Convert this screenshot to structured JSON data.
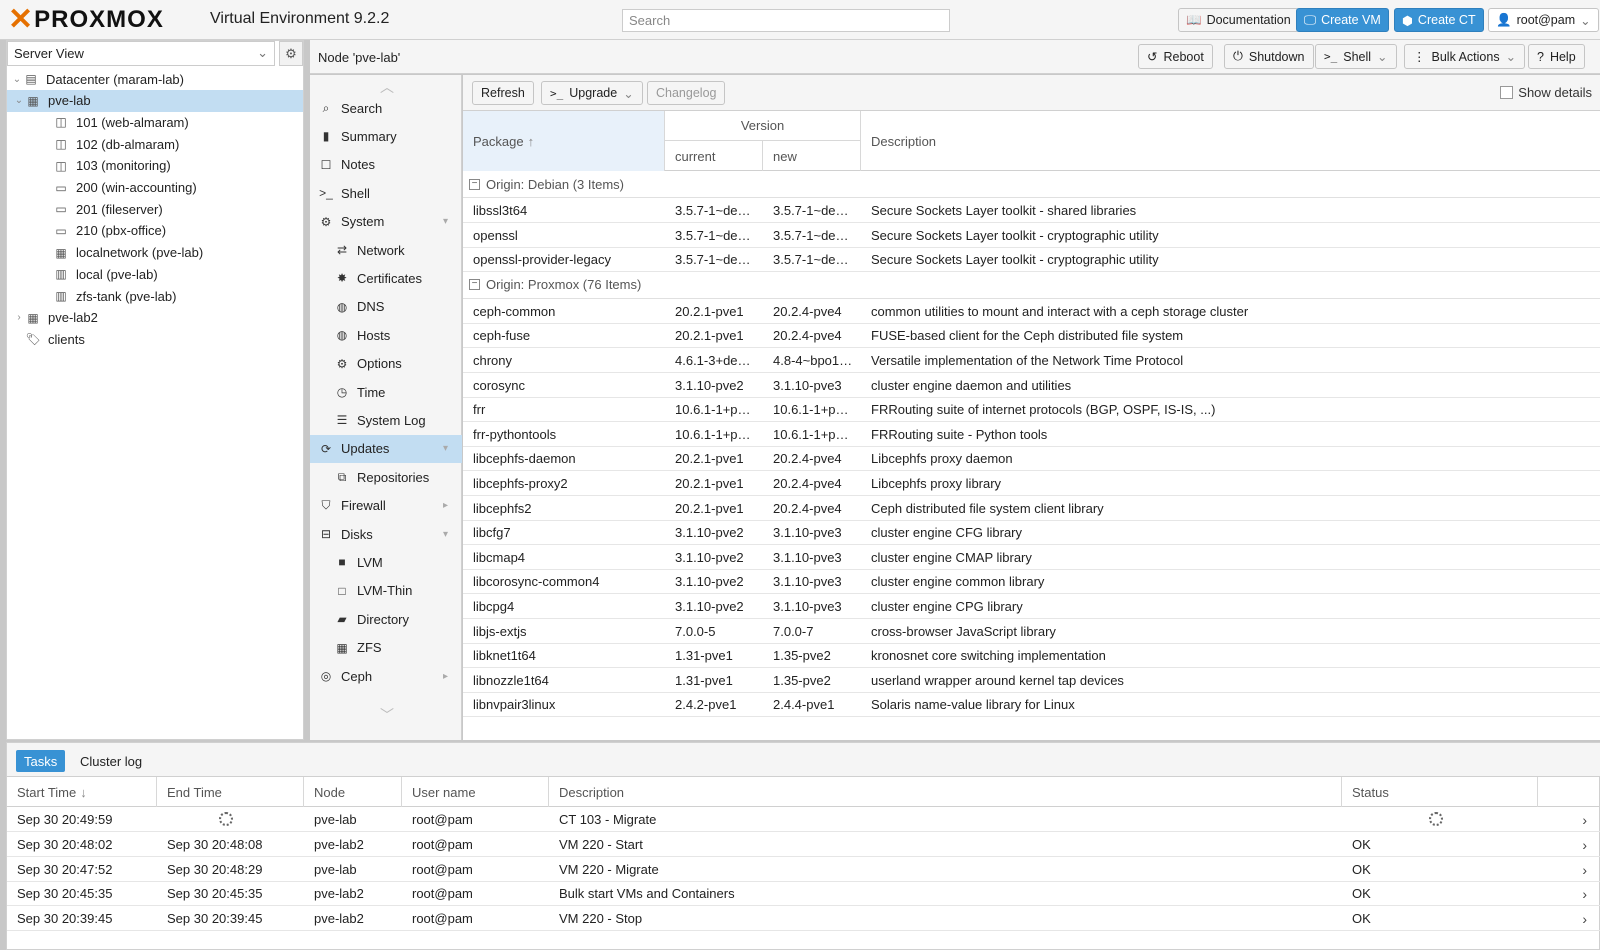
{
  "app": {
    "logo_text": "PROXMOX",
    "product": "Virtual Environment 9.2.2",
    "search_placeholder": "Search",
    "documentation": "Documentation",
    "create_vm": "Create VM",
    "create_ct": "Create CT",
    "user": "root@pam"
  },
  "tree": {
    "view": "Server View",
    "items": [
      {
        "label": "Datacenter (maram-lab)",
        "icon": "datacenter-icon"
      },
      {
        "label": "pve-lab",
        "icon": "node-online-icon"
      },
      {
        "label": "101 (web-almaram)",
        "icon": "container-icon"
      },
      {
        "label": "102 (db-almaram)",
        "icon": "container-icon"
      },
      {
        "label": "103 (monitoring)",
        "icon": "container-migrating-icon"
      },
      {
        "label": "200 (win-accounting)",
        "icon": "vm-icon"
      },
      {
        "label": "201 (fileserver)",
        "icon": "vm-icon"
      },
      {
        "label": "210 (pbx-office)",
        "icon": "vm-icon"
      },
      {
        "label": "localnetwork (pve-lab)",
        "icon": "network-icon"
      },
      {
        "label": "local (pve-lab)",
        "icon": "storage-icon"
      },
      {
        "label": "zfs-tank (pve-lab)",
        "icon": "storage-icon"
      },
      {
        "label": "pve-lab2",
        "icon": "node-online-icon"
      },
      {
        "label": "clients",
        "icon": "tags-icon"
      }
    ]
  },
  "node": {
    "title": "Node 'pve-lab'",
    "reboot": "Reboot",
    "shutdown": "Shutdown",
    "shell": "Shell",
    "bulk_actions": "Bulk Actions",
    "help": "Help"
  },
  "nav": [
    {
      "label": "Search",
      "icon": "search-icon",
      "sub": false
    },
    {
      "label": "Summary",
      "icon": "summary-icon",
      "sub": false
    },
    {
      "label": "Notes",
      "icon": "notes-icon",
      "sub": false
    },
    {
      "label": "Shell",
      "icon": "terminal-icon",
      "sub": false
    },
    {
      "label": "System",
      "icon": "cogs-icon",
      "sub": false
    },
    {
      "label": "Network",
      "icon": "network-icon",
      "sub": true
    },
    {
      "label": "Certificates",
      "icon": "certificate-icon",
      "sub": true
    },
    {
      "label": "DNS",
      "icon": "globe-icon",
      "sub": true
    },
    {
      "label": "Hosts",
      "icon": "globe-icon",
      "sub": true
    },
    {
      "label": "Options",
      "icon": "gear-icon",
      "sub": true
    },
    {
      "label": "Time",
      "icon": "clock-icon",
      "sub": true
    },
    {
      "label": "System Log",
      "icon": "list-icon",
      "sub": true
    },
    {
      "label": "Updates",
      "icon": "refresh-icon",
      "sub": false
    },
    {
      "label": "Repositories",
      "icon": "files-icon",
      "sub": true
    },
    {
      "label": "Firewall",
      "icon": "shield-icon",
      "sub": false
    },
    {
      "label": "Disks",
      "icon": "hdd-icon",
      "sub": false
    },
    {
      "label": "LVM",
      "icon": "square-icon",
      "sub": true
    },
    {
      "label": "LVM-Thin",
      "icon": "square-outline-icon",
      "sub": true
    },
    {
      "label": "Directory",
      "icon": "folder-icon",
      "sub": true
    },
    {
      "label": "ZFS",
      "icon": "grid-icon",
      "sub": true
    },
    {
      "label": "Ceph",
      "icon": "ceph-icon",
      "sub": false
    }
  ],
  "updates": {
    "refresh": "Refresh",
    "upgrade": "Upgrade",
    "changelog": "Changelog",
    "show_details": "Show details",
    "columns": {
      "package": "Package",
      "version": "Version",
      "current": "current",
      "new": "new",
      "description": "Description"
    },
    "groups": [
      {
        "title": "Origin: Debian (3 Items)",
        "rows": [
          [
            "libssl3t64",
            "3.5.7-1~de…",
            "3.5.7-1~de…",
            "Secure Sockets Layer toolkit - shared libraries"
          ],
          [
            "openssl",
            "3.5.7-1~de…",
            "3.5.7-1~de…",
            "Secure Sockets Layer toolkit - cryptographic utility"
          ],
          [
            "openssl-provider-legacy",
            "3.5.7-1~de…",
            "3.5.7-1~de…",
            "Secure Sockets Layer toolkit - cryptographic utility"
          ]
        ]
      },
      {
        "title": "Origin: Proxmox (76 Items)",
        "rows": [
          [
            "ceph-common",
            "20.2.1-pve1",
            "20.2.4-pve4",
            "common utilities to mount and interact with a ceph storage cluster"
          ],
          [
            "ceph-fuse",
            "20.2.1-pve1",
            "20.2.4-pve4",
            "FUSE-based client for the Ceph distributed file system"
          ],
          [
            "chrony",
            "4.6.1-3+de…",
            "4.8-4~bpo1…",
            "Versatile implementation of the Network Time Protocol"
          ],
          [
            "corosync",
            "3.1.10-pve2",
            "3.1.10-pve3",
            "cluster engine daemon and utilities"
          ],
          [
            "frr",
            "10.6.1-1+p…",
            "10.6.1-1+p…",
            "FRRouting suite of internet protocols (BGP, OSPF, IS-IS, ...)"
          ],
          [
            "frr-pythontools",
            "10.6.1-1+p…",
            "10.6.1-1+p…",
            "FRRouting suite - Python tools"
          ],
          [
            "libcephfs-daemon",
            "20.2.1-pve1",
            "20.2.4-pve4",
            "Libcephfs proxy daemon"
          ],
          [
            "libcephfs-proxy2",
            "20.2.1-pve1",
            "20.2.4-pve4",
            "Libcephfs proxy library"
          ],
          [
            "libcephfs2",
            "20.2.1-pve1",
            "20.2.4-pve4",
            "Ceph distributed file system client library"
          ],
          [
            "libcfg7",
            "3.1.10-pve2",
            "3.1.10-pve3",
            "cluster engine CFG library"
          ],
          [
            "libcmap4",
            "3.1.10-pve2",
            "3.1.10-pve3",
            "cluster engine CMAP library"
          ],
          [
            "libcorosync-common4",
            "3.1.10-pve2",
            "3.1.10-pve3",
            "cluster engine common library"
          ],
          [
            "libcpg4",
            "3.1.10-pve2",
            "3.1.10-pve3",
            "cluster engine CPG library"
          ],
          [
            "libjs-extjs",
            "7.0.0-5",
            "7.0.0-7",
            "cross-browser JavaScript library"
          ],
          [
            "libknet1t64",
            "1.31-pve1",
            "1.35-pve2",
            "kronosnet core switching implementation"
          ],
          [
            "libnozzle1t64",
            "1.31-pve1",
            "1.35-pve2",
            "userland wrapper around kernel tap devices"
          ],
          [
            "libnvpair3linux",
            "2.4.2-pve1",
            "2.4.4-pve1",
            "Solaris name-value library for Linux"
          ]
        ]
      }
    ]
  },
  "tasks": {
    "tab_tasks": "Tasks",
    "tab_cluster_log": "Cluster log",
    "columns": [
      "Start Time",
      "End Time",
      "Node",
      "User name",
      "Description",
      "Status"
    ],
    "rows": [
      {
        "start": "Sep 30 20:49:59",
        "end": "",
        "node": "pve-lab",
        "user": "root@pam",
        "desc": "CT 103 - Migrate",
        "status": "",
        "running": true
      },
      {
        "start": "Sep 30 20:48:02",
        "end": "Sep 30 20:48:08",
        "node": "pve-lab2",
        "user": "root@pam",
        "desc": "VM 220 - Start",
        "status": "OK",
        "running": false
      },
      {
        "start": "Sep 30 20:47:52",
        "end": "Sep 30 20:48:29",
        "node": "pve-lab",
        "user": "root@pam",
        "desc": "VM 220 - Migrate",
        "status": "OK",
        "running": false
      },
      {
        "start": "Sep 30 20:45:35",
        "end": "Sep 30 20:45:35",
        "node": "pve-lab2",
        "user": "root@pam",
        "desc": "Bulk start VMs and Containers",
        "status": "OK",
        "running": false
      },
      {
        "start": "Sep 30 20:39:45",
        "end": "Sep 30 20:39:45",
        "node": "pve-lab2",
        "user": "root@pam",
        "desc": "VM 220 - Stop",
        "status": "OK",
        "running": false
      }
    ]
  }
}
